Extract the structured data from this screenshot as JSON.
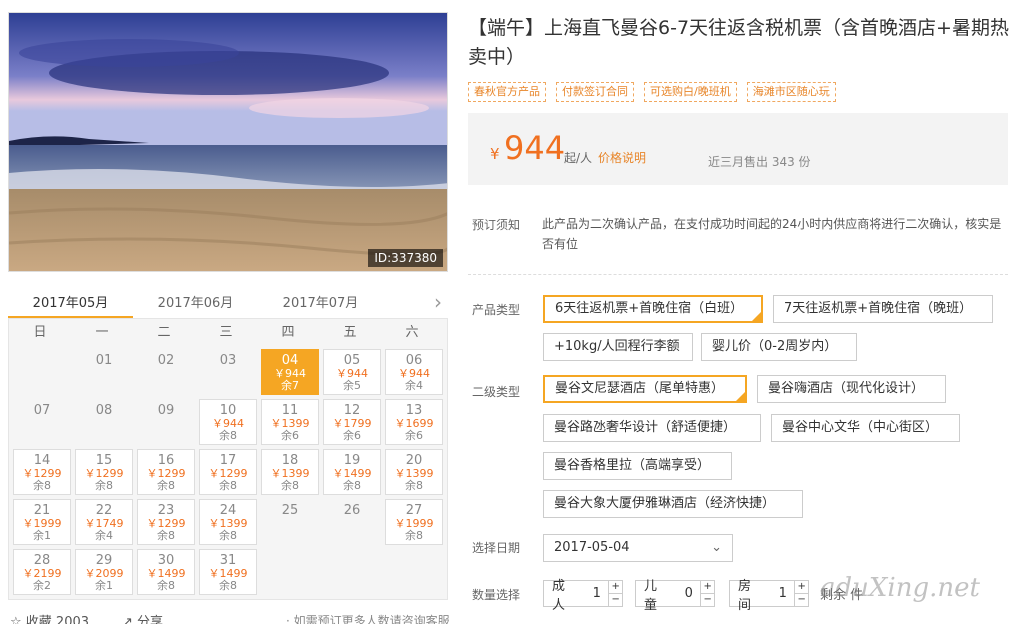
{
  "image_id": "ID:337380",
  "months": [
    "2017年05月",
    "2017年06月",
    "2017年07月"
  ],
  "weekdays": [
    "日",
    "一",
    "二",
    "三",
    "四",
    "五",
    "六"
  ],
  "calendar": [
    {
      "row": 0,
      "col": 1,
      "d": "01"
    },
    {
      "row": 0,
      "col": 2,
      "d": "02"
    },
    {
      "row": 0,
      "col": 3,
      "d": "03"
    },
    {
      "row": 0,
      "col": 4,
      "d": "04",
      "p": "￥944",
      "r": "余7",
      "sel": true
    },
    {
      "row": 0,
      "col": 5,
      "d": "05",
      "p": "￥944",
      "r": "余5"
    },
    {
      "row": 0,
      "col": 6,
      "d": "06",
      "p": "￥944",
      "r": "余4"
    },
    {
      "row": 1,
      "col": 0,
      "d": "07"
    },
    {
      "row": 1,
      "col": 1,
      "d": "08"
    },
    {
      "row": 1,
      "col": 2,
      "d": "09"
    },
    {
      "row": 1,
      "col": 3,
      "d": "10",
      "p": "￥944",
      "r": "余8"
    },
    {
      "row": 1,
      "col": 4,
      "d": "11",
      "p": "￥1399",
      "r": "余6"
    },
    {
      "row": 1,
      "col": 5,
      "d": "12",
      "p": "￥1799",
      "r": "余6"
    },
    {
      "row": 1,
      "col": 6,
      "d": "13",
      "p": "￥1699",
      "r": "余6"
    },
    {
      "row": 2,
      "col": 0,
      "d": "14",
      "p": "￥1299",
      "r": "余8"
    },
    {
      "row": 2,
      "col": 1,
      "d": "15",
      "p": "￥1299",
      "r": "余8"
    },
    {
      "row": 2,
      "col": 2,
      "d": "16",
      "p": "￥1299",
      "r": "余8"
    },
    {
      "row": 2,
      "col": 3,
      "d": "17",
      "p": "￥1299",
      "r": "余8"
    },
    {
      "row": 2,
      "col": 4,
      "d": "18",
      "p": "￥1399",
      "r": "余8"
    },
    {
      "row": 2,
      "col": 5,
      "d": "19",
      "p": "￥1499",
      "r": "余8"
    },
    {
      "row": 2,
      "col": 6,
      "d": "20",
      "p": "￥1399",
      "r": "余8"
    },
    {
      "row": 3,
      "col": 0,
      "d": "21",
      "p": "￥1999",
      "r": "余1"
    },
    {
      "row": 3,
      "col": 1,
      "d": "22",
      "p": "￥1749",
      "r": "余4"
    },
    {
      "row": 3,
      "col": 2,
      "d": "23",
      "p": "￥1299",
      "r": "余8"
    },
    {
      "row": 3,
      "col": 3,
      "d": "24",
      "p": "￥1399",
      "r": "余8"
    },
    {
      "row": 3,
      "col": 4,
      "d": "25"
    },
    {
      "row": 3,
      "col": 5,
      "d": "26"
    },
    {
      "row": 3,
      "col": 6,
      "d": "27",
      "p": "￥1999",
      "r": "余8"
    },
    {
      "row": 4,
      "col": 0,
      "d": "28",
      "p": "￥2199",
      "r": "余2"
    },
    {
      "row": 4,
      "col": 1,
      "d": "29",
      "p": "￥2099",
      "r": "余1"
    },
    {
      "row": 4,
      "col": 2,
      "d": "30",
      "p": "￥1499",
      "r": "余8"
    },
    {
      "row": 4,
      "col": 3,
      "d": "31",
      "p": "￥1499",
      "r": "余8"
    }
  ],
  "favorite": "收藏 2003",
  "share": "分享",
  "consult": "· 如需预订更多人数请咨询客服",
  "title": "【端午】上海直飞曼谷6-7天往返含税机票（含首晚酒店+暑期热卖中）",
  "tags": [
    "春秋官方产品",
    "付款签订合同",
    "可选购白/晚班机",
    "海滩市区随心玩"
  ],
  "price": {
    "currency": "¥",
    "amount": "944",
    "unit": "起/人",
    "explain": "价格说明",
    "sold": "近三月售出 343 份"
  },
  "notice_label": "预订须知",
  "notice_text": "此产品为二次确认产品，在支付成功时间起的24小时内供应商将进行二次确认，核实是否有位",
  "product_label": "产品类型",
  "products": [
    "6天往返机票+首晚住宿（白班）",
    "7天往返机票+首晚住宿（晚班）",
    "+10kg/人回程行李额",
    "婴儿价（0-2周岁内）"
  ],
  "sub_label": "二级类型",
  "subs": [
    "曼谷文尼瑟酒店（尾单特惠）",
    "曼谷嗨酒店（现代化设计）",
    "曼谷路氹奢华设计（舒适便捷）",
    "曼谷中心文华（中心街区）",
    "曼谷香格里拉（高端享受）",
    "曼谷大象大厦伊雅琳酒店（经济快捷）"
  ],
  "date_label": "选择日期",
  "date_value": "2017-05-04",
  "qty_label": "数量选择",
  "steppers": [
    {
      "label": "成人",
      "value": "1"
    },
    {
      "label": "儿童",
      "value": "0"
    },
    {
      "label": "房间",
      "value": "1"
    }
  ],
  "remain": "剩余 件",
  "watermark": "aduXing.net"
}
